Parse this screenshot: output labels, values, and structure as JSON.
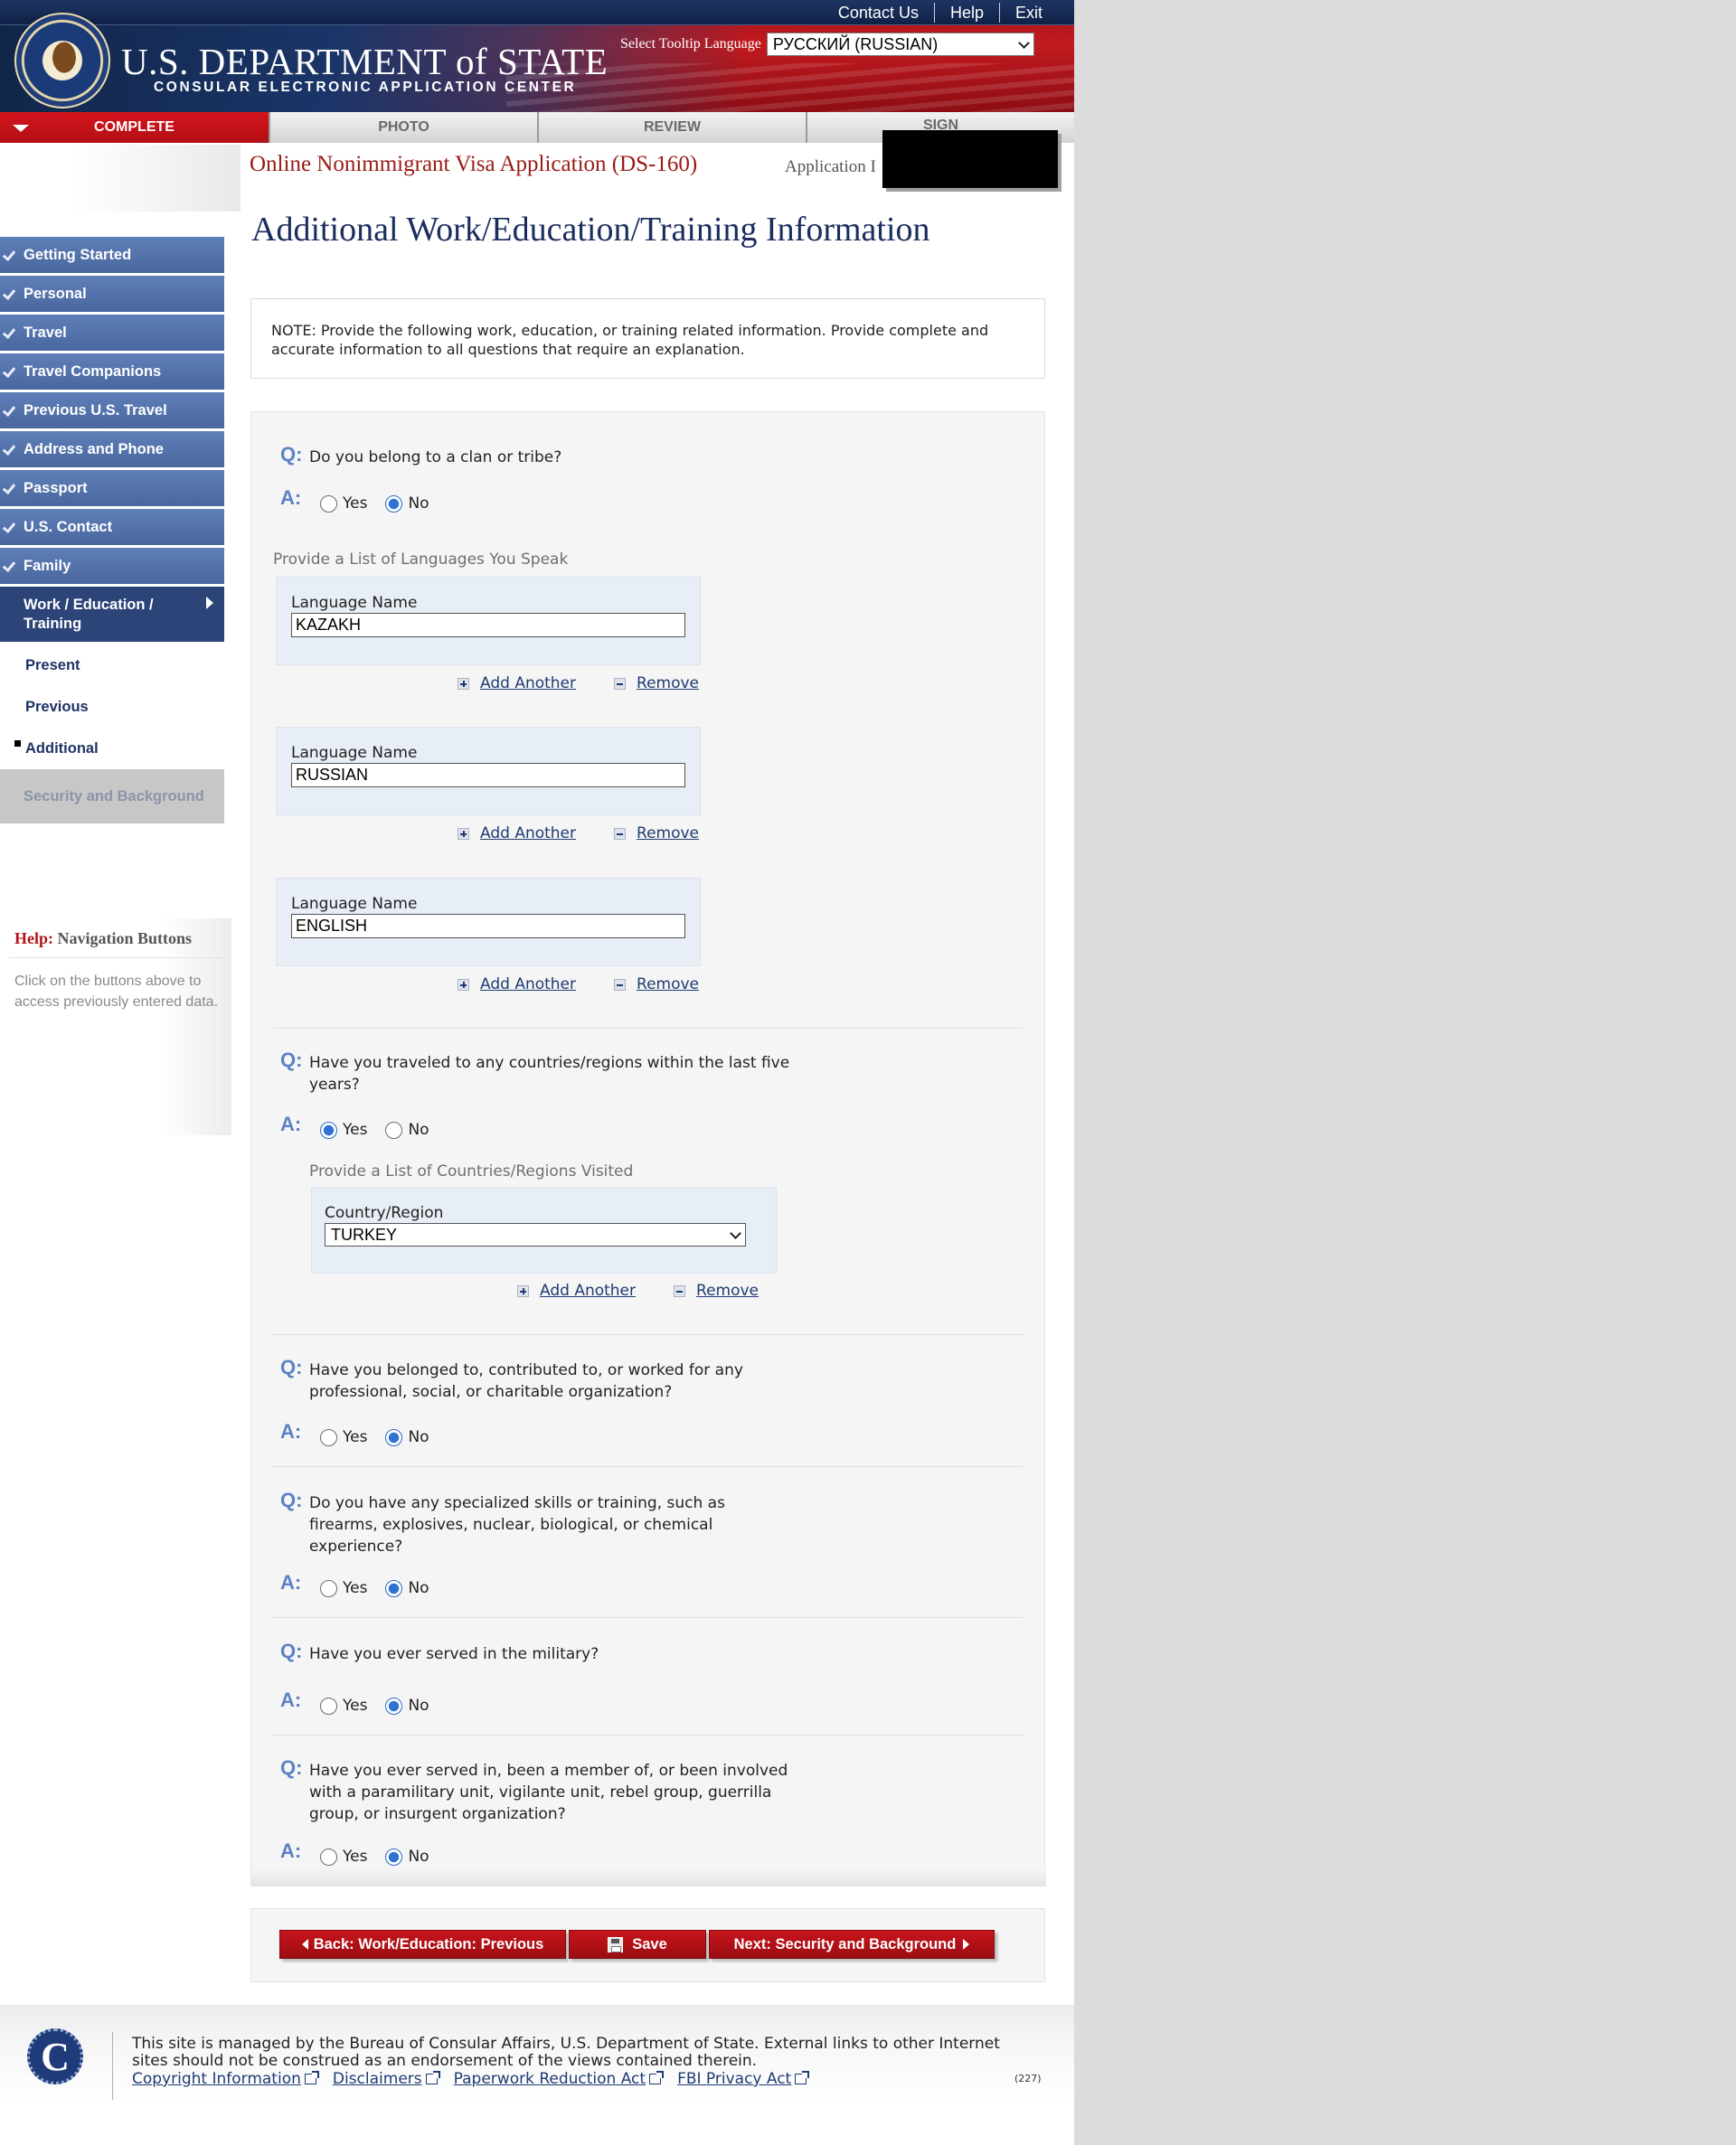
{
  "header": {
    "top_links": [
      "Contact Us",
      "Help",
      "Exit"
    ],
    "brand": "U.S. DEPARTMENT of STATE",
    "brand_sub": "CONSULAR ELECTRONIC APPLICATION CENTER",
    "tooltip_label": "Select Tooltip Language",
    "tooltip_value": "РУССКИЙ (RUSSIAN)"
  },
  "tabs": [
    {
      "label": "COMPLETE",
      "state": "active"
    },
    {
      "label": "PHOTO"
    },
    {
      "label": "REVIEW"
    },
    {
      "label": "SIGN"
    }
  ],
  "app": {
    "title": "Online Nonimmigrant Visa Application (DS-160)",
    "id_label": "Application I"
  },
  "sidebar": {
    "items": [
      {
        "label": "Getting Started"
      },
      {
        "label": "Personal"
      },
      {
        "label": "Travel"
      },
      {
        "label": "Travel Companions"
      },
      {
        "label": "Previous U.S. Travel"
      },
      {
        "label": "Address and Phone"
      },
      {
        "label": "Passport"
      },
      {
        "label": "U.S. Contact"
      },
      {
        "label": "Family"
      }
    ],
    "current": "Work / Education / Training",
    "subitems": [
      "Present",
      "Previous",
      "Additional"
    ],
    "disabled": "Security and Background"
  },
  "help": {
    "prefix": "Help:",
    "title": "Navigation Buttons",
    "text": "Click on the buttons above to access previously entered data."
  },
  "main": {
    "title": "Additional Work/Education/Training Information",
    "note": "NOTE: Provide the following work, education, or training related information. Provide complete and accurate information to all questions that require an explanation.",
    "q_marker": "Q:",
    "a_marker": "A:",
    "yes": "Yes",
    "no": "No",
    "questions": [
      {
        "text": "Do you belong to a clan or tribe?",
        "answer": "No"
      },
      {
        "text": "Have you traveled to any countries/regions within the last five years?",
        "answer": "Yes"
      },
      {
        "text": "Have you belonged to, contributed to, or worked for any professional, social, or charitable organization?",
        "answer": "No"
      },
      {
        "text": "Do you have any specialized skills or training, such as firearms, explosives, nuclear, biological, or chemical experience?",
        "answer": "No"
      },
      {
        "text": "Have you ever served in the military?",
        "answer": "No"
      },
      {
        "text": "Have you ever served in, been a member of, or been involved with a paramilitary unit, vigilante unit, rebel group, guerrilla group, or insurgent organization?",
        "answer": "No"
      }
    ],
    "languages_label": "Provide a List of Languages You Speak",
    "language_field_label": "Language Name",
    "languages": [
      "KAZAKH",
      "RUSSIAN",
      "ENGLISH"
    ],
    "countries_label": "Provide a List of Countries/Regions Visited",
    "country_field_label": "Country/Region",
    "country_value": "TURKEY",
    "add_another": "Add Another",
    "remove": "Remove"
  },
  "buttons": {
    "back": "Back: Work/Education: Previous",
    "save": "Save",
    "next": "Next: Security and Background"
  },
  "footer": {
    "text": "This site is managed by the Bureau of Consular Affairs, U.S. Department of State. External links to other Internet sites should not be construed as an endorsement of the views contained therein.",
    "links": [
      "Copyright Information",
      "Disclaimers",
      "Paperwork Reduction Act",
      "FBI Privacy Act"
    ],
    "code": "(227)",
    "logo_letter": "C"
  }
}
